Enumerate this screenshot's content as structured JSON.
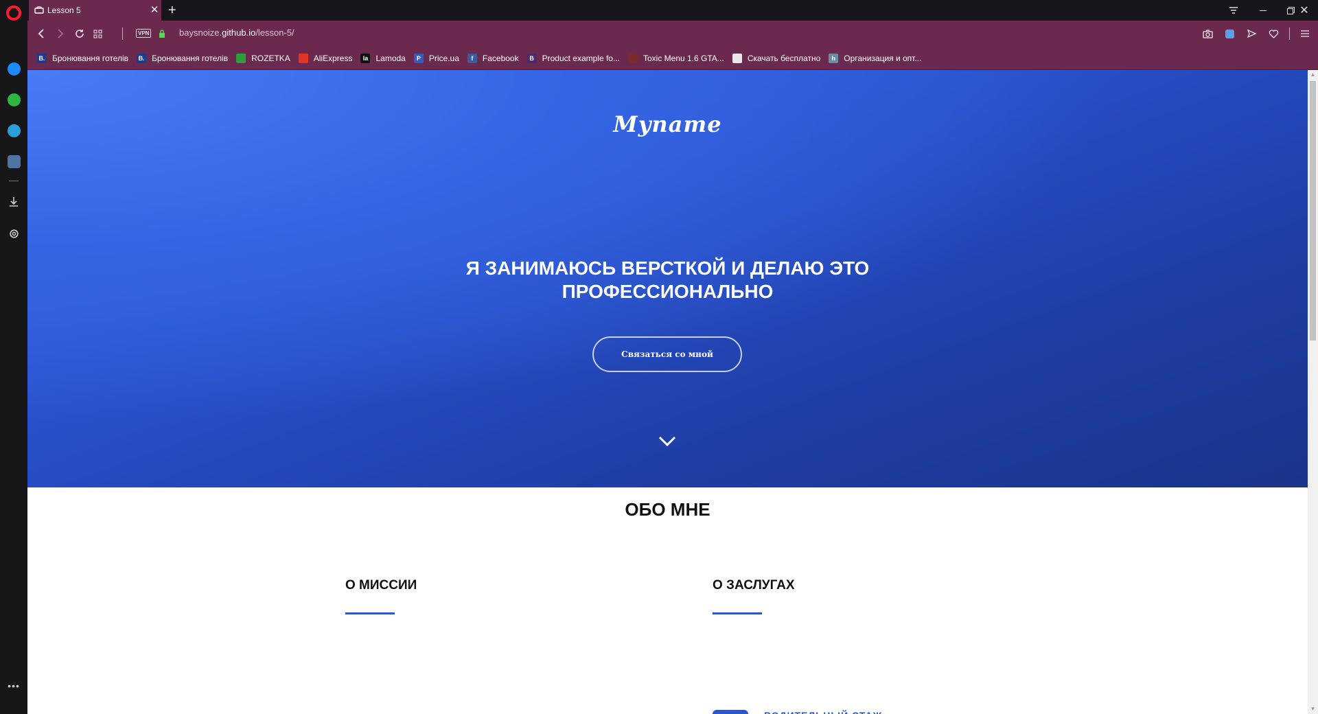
{
  "browser": {
    "tab": {
      "title": "Lesson 5"
    },
    "url": {
      "host_prefix": "baysnoize.",
      "host_main": "github.io",
      "path": "/lesson-5/"
    },
    "vpn_label": "VPN",
    "bookmarks": [
      {
        "label": "Бронювання готелів",
        "icon": "booking-icon",
        "icon_text": "B.",
        "color": "#1e3c8c"
      },
      {
        "label": "Бронювання готелів",
        "icon": "booking-icon",
        "icon_text": "B.",
        "color": "#1e3c8c"
      },
      {
        "label": "ROZETKA",
        "icon": "rozetka-icon",
        "icon_text": "",
        "color": "#2e9e3a"
      },
      {
        "label": "AliExpress",
        "icon": "aliexpress-icon",
        "icon_text": "",
        "color": "#e43225"
      },
      {
        "label": "Lamoda",
        "icon": "lamoda-icon",
        "icon_text": "la",
        "color": "#111111"
      },
      {
        "label": "Price.ua",
        "icon": "priceua-icon",
        "icon_text": "P",
        "color": "#3a58b8"
      },
      {
        "label": "Facebook",
        "icon": "facebook-icon",
        "icon_text": "f",
        "color": "#3b5b9e"
      },
      {
        "label": "Product example fo...",
        "icon": "bootstrap-icon",
        "icon_text": "B",
        "color": "#4b2a72"
      },
      {
        "label": "Toxic Menu 1.6 GTA...",
        "icon": "toxic-icon",
        "icon_text": "",
        "color": "#7a2b2b"
      },
      {
        "label": "Скачать бесплатно",
        "icon": "document-icon",
        "icon_text": "",
        "color": "#e8e8e8"
      },
      {
        "label": "Организация и опт...",
        "icon": "habr-icon",
        "icon_text": "h",
        "color": "#6d8ba5"
      }
    ]
  },
  "page": {
    "logo": "Myname",
    "hero_title_line1": "Я ЗАНИМАЮСЬ ВЕРСТКОЙ И ДЕЛАЮ ЭТО",
    "hero_title_line2": "ПРОФЕССИОНАЛЬНО",
    "cta_label": "Связаться со мной",
    "about_title": "ОБО МНЕ",
    "mission_title": "О МИССИИ",
    "merits_title": "О ЗАСЛУГАХ",
    "merit_item_label": "ВОДИТЕЛЬНЫЙ СТАЖ"
  },
  "colors": {
    "accent": "#2e56c8",
    "browser_chrome": "#6b2a4d"
  }
}
